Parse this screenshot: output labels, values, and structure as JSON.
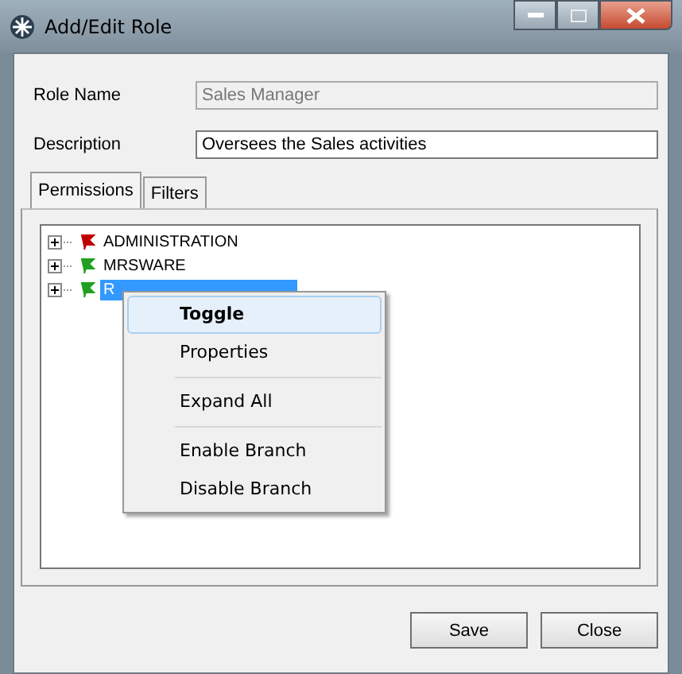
{
  "window": {
    "title": "Add/Edit Role"
  },
  "fields": [
    {
      "label": "Role Name",
      "value": "Sales Manager",
      "disabled": true
    },
    {
      "label": "Description",
      "value": "Oversees the Sales activities",
      "disabled": false
    }
  ],
  "tabs": [
    {
      "label": "Permissions",
      "selected": true
    },
    {
      "label": "Filters",
      "selected": false
    }
  ],
  "tree": [
    {
      "label": "ADMINISTRATION",
      "color": "#c00000",
      "selected": false
    },
    {
      "label": "MRSWARE",
      "color": "#20a020",
      "selected": false
    },
    {
      "label": "R",
      "color": "#20a020",
      "selected": true
    }
  ],
  "context_menu": [
    {
      "kind": "item",
      "label": "Toggle",
      "selected": true
    },
    {
      "kind": "item",
      "label": "Properties",
      "selected": false
    },
    {
      "kind": "separator"
    },
    {
      "kind": "item",
      "label": "Expand All",
      "selected": false
    },
    {
      "kind": "separator"
    },
    {
      "kind": "item",
      "label": "Enable Branch",
      "selected": false
    },
    {
      "kind": "item",
      "label": "Disable Branch",
      "selected": false
    }
  ],
  "buttons": [
    "Save",
    "Close"
  ]
}
